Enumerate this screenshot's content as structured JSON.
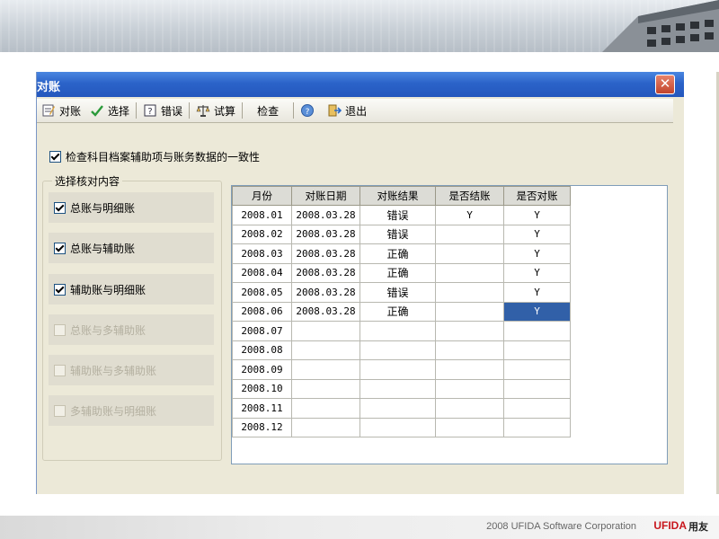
{
  "window": {
    "title": "对账"
  },
  "toolbar": [
    {
      "label": "对账",
      "icon": "reconcile-icon"
    },
    {
      "label": "选择",
      "icon": "checkmark-icon"
    },
    {
      "label": "错误",
      "icon": "help-icon"
    },
    {
      "label": "试算",
      "icon": "scales-icon"
    },
    {
      "label": "检查",
      "icon": ""
    },
    {
      "label": "",
      "icon": "info-icon"
    },
    {
      "label": "退出",
      "icon": "exit-icon"
    }
  ],
  "top_check": {
    "label": "检查科目档案辅助项与账务数据的一致性",
    "checked": true
  },
  "options_group": {
    "title": "选择核对内容",
    "items": [
      {
        "label": "总账与明细账",
        "checked": true,
        "enabled": true
      },
      {
        "label": "总账与辅助账",
        "checked": true,
        "enabled": true
      },
      {
        "label": "辅助账与明细账",
        "checked": true,
        "enabled": true
      },
      {
        "label": "总账与多辅助账",
        "checked": false,
        "enabled": false
      },
      {
        "label": "辅助账与多辅助账",
        "checked": false,
        "enabled": false
      },
      {
        "label": "多辅助账与明细账",
        "checked": false,
        "enabled": false
      }
    ]
  },
  "grid": {
    "columns": [
      "月份",
      "对账日期",
      "对账结果",
      "是否结账",
      "是否对账"
    ],
    "rows": [
      [
        "2008.01",
        "2008.03.28",
        "错误",
        "Y",
        "Y"
      ],
      [
        "2008.02",
        "2008.03.28",
        "错误",
        "",
        "Y"
      ],
      [
        "2008.03",
        "2008.03.28",
        "正确",
        "",
        "Y"
      ],
      [
        "2008.04",
        "2008.03.28",
        "正确",
        "",
        "Y"
      ],
      [
        "2008.05",
        "2008.03.28",
        "错误",
        "",
        "Y"
      ],
      [
        "2008.06",
        "2008.03.28",
        "正确",
        "",
        "Y"
      ],
      [
        "2008.07",
        "",
        "",
        "",
        ""
      ],
      [
        "2008.08",
        "",
        "",
        "",
        ""
      ],
      [
        "2008.09",
        "",
        "",
        "",
        ""
      ],
      [
        "2008.10",
        "",
        "",
        "",
        ""
      ],
      [
        "2008.11",
        "",
        "",
        "",
        ""
      ],
      [
        "2008.12",
        "",
        "",
        "",
        ""
      ]
    ],
    "selected": {
      "row": 5,
      "col": 4
    }
  },
  "footer": {
    "text": "2008 UFIDA Software Corporation",
    "brand": "UFIDA",
    "brand_cn": "用友"
  },
  "colors": {
    "titlebar": "#2b63c9",
    "selection": "#3160a8",
    "dialog_bg": "#ece9d8",
    "brand_red": "#c8161d"
  }
}
